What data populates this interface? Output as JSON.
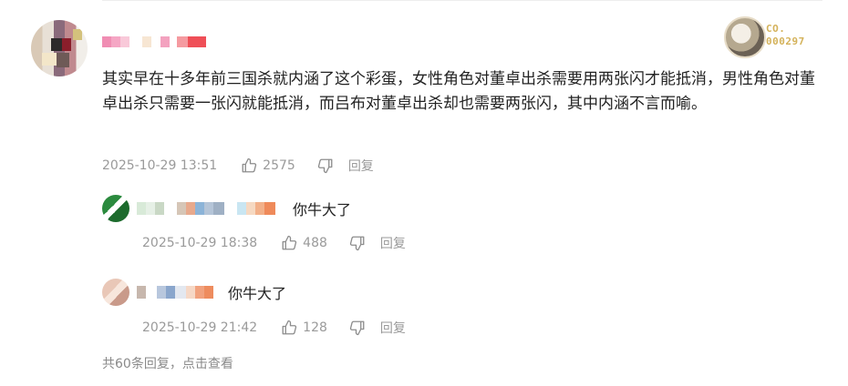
{
  "main_comment": {
    "badge_text": [
      "CO.",
      "000297"
    ],
    "body": "其实早在十多年前三国杀就内涵了这个彩蛋，女性角色对董卓出杀需要用两张闪才能抵消，男性角色对董卓出杀只需要一张闪就能抵消，而吕布对董卓出杀却也需要两张闪，其中内涵不言而喻。",
    "time": "2025-10-29 13:51",
    "likes": "2575",
    "reply_label": "回复"
  },
  "replies": [
    {
      "text": "你牛大了",
      "time": "2025-10-29 18:38",
      "likes": "488",
      "reply_label": "回复"
    },
    {
      "text": "你牛大了",
      "time": "2025-10-29 21:42",
      "likes": "128",
      "reply_label": "回复"
    }
  ],
  "footer": {
    "view_replies": "共60条回复，点击查看"
  },
  "colors": {
    "meta_text": "#9a9a9a",
    "badge_gold": "#d4b25a",
    "body_text": "#222222"
  },
  "icons": [
    "thumbs-up-icon",
    "thumbs-down-icon"
  ]
}
